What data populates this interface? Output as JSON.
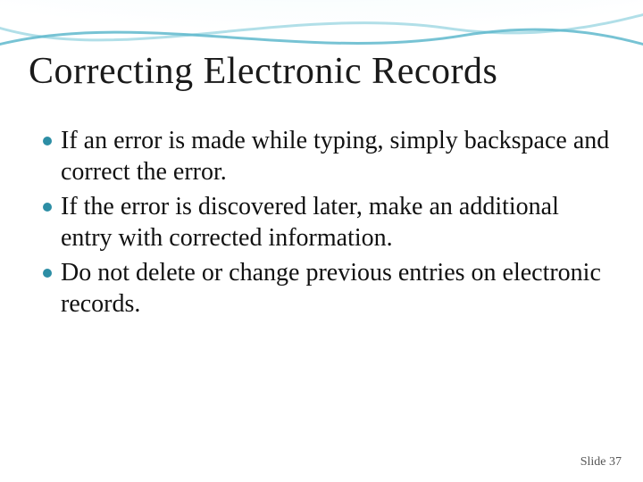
{
  "slide": {
    "title": "Correcting Electronic Records",
    "bullets": [
      "If an error is made while typing, simply backspace and correct the error.",
      "If the error is discovered later, make an additional entry with corrected information.",
      "Do not delete or change previous entries on electronic records."
    ],
    "footer": "Slide 37"
  },
  "colors": {
    "bullet_dot": "#2d8ea5",
    "wave_light": "#a8dbe6",
    "wave_dark": "#5fb8cc"
  }
}
